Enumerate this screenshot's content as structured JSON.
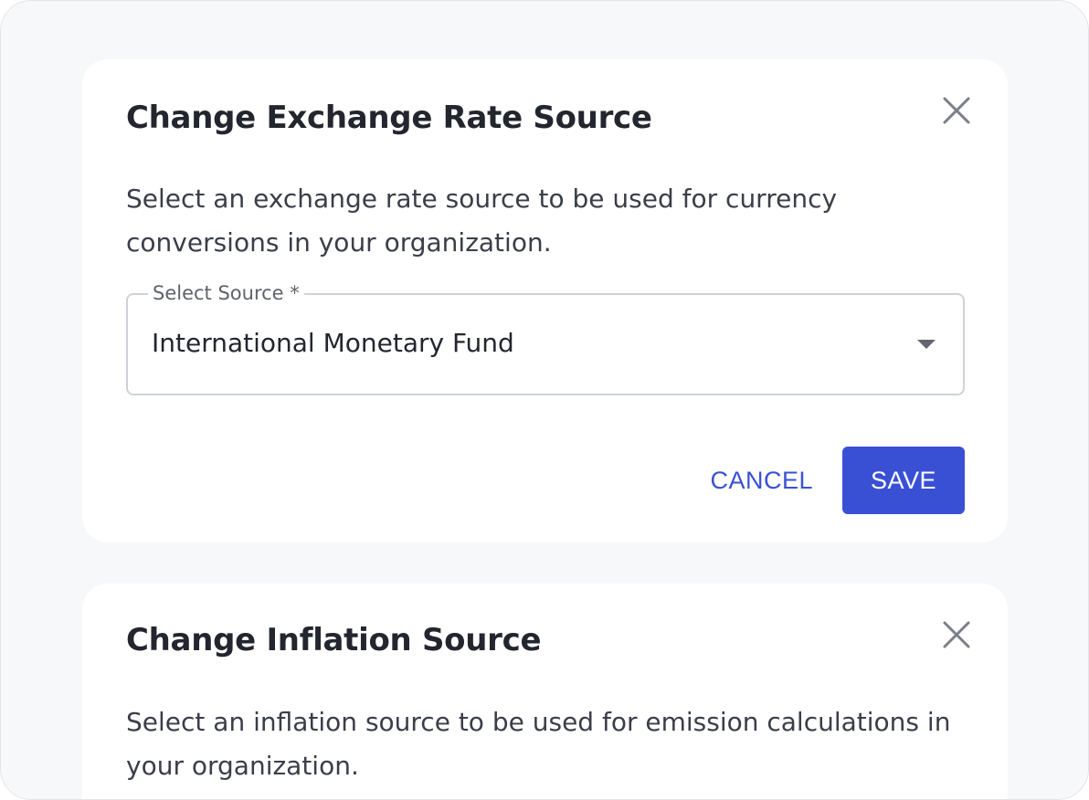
{
  "exchange_rate_dialog": {
    "title": "Change Exchange Rate Source",
    "description": "Select an exchange rate source to be used for currency conversions in your organization.",
    "close_icon": "close-icon",
    "select": {
      "label": "Select Source *",
      "value": "International Monetary Fund",
      "arrow_icon": "dropdown-arrow-icon"
    },
    "cancel_label": "CANCEL",
    "save_label": "SAVE"
  },
  "inflation_dialog": {
    "title": "Change Inflation Source",
    "description": "Select an inflation source to be used for emission calculations in your organization.",
    "close_icon": "close-icon"
  },
  "colors": {
    "accent": "#3a50d4",
    "background": "#f7f8fa",
    "card": "#ffffff",
    "title_text": "#23262e",
    "body_text": "#3a3e48",
    "border": "#cfd2d8"
  }
}
